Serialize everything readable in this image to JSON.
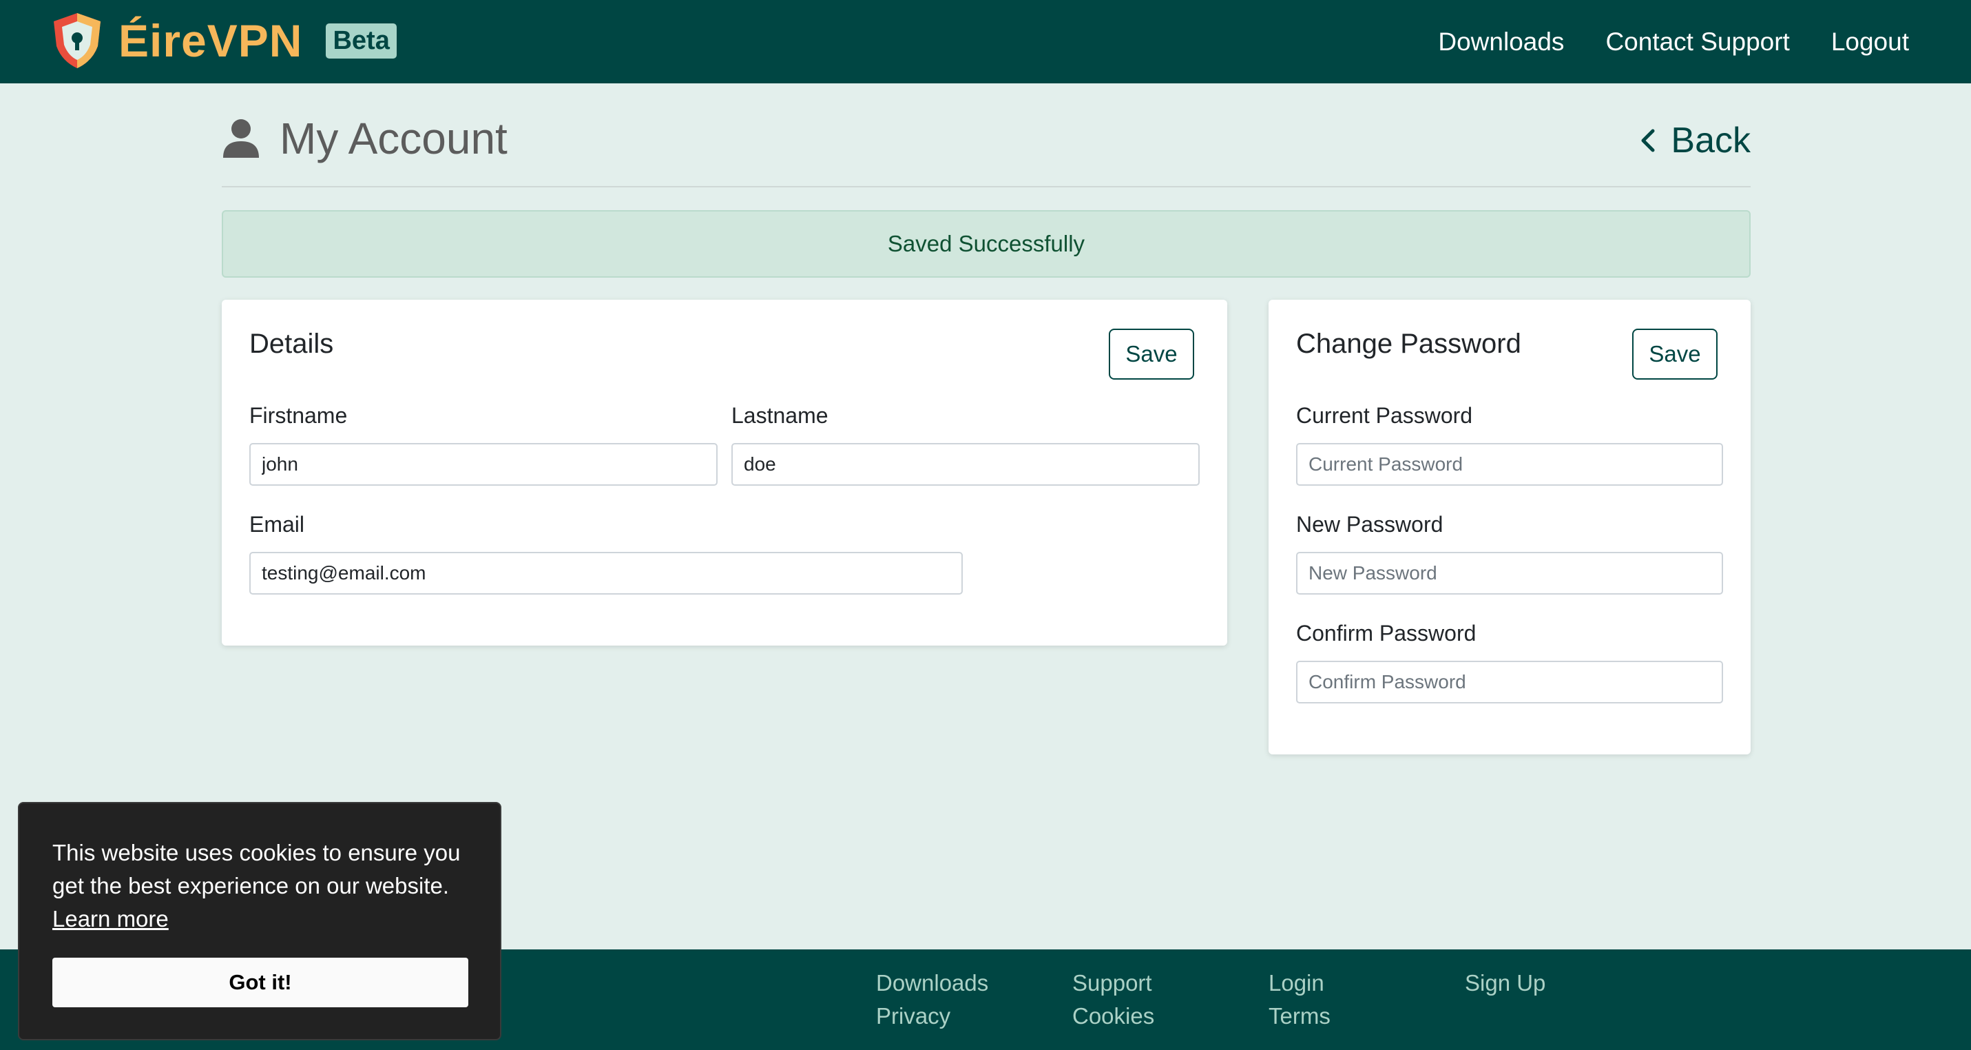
{
  "header": {
    "brand_name": "ÉireVPN",
    "beta_label": "Beta",
    "nav": [
      {
        "label": "Downloads"
      },
      {
        "label": "Contact Support"
      },
      {
        "label": "Logout"
      }
    ]
  },
  "page": {
    "title": "My Account",
    "back_label": "Back"
  },
  "alert": {
    "message": "Saved Successfully"
  },
  "details": {
    "title": "Details",
    "save_label": "Save",
    "firstname": {
      "label": "Firstname",
      "value": "john"
    },
    "lastname": {
      "label": "Lastname",
      "value": "doe"
    },
    "email": {
      "label": "Email",
      "value": "testing@email.com"
    }
  },
  "password": {
    "title": "Change Password",
    "save_label": "Save",
    "current": {
      "label": "Current Password",
      "placeholder": "Current Password"
    },
    "new": {
      "label": "New Password",
      "placeholder": "New Password"
    },
    "confirm": {
      "label": "Confirm Password",
      "placeholder": "Confirm Password"
    }
  },
  "cookie": {
    "text": "This website uses cookies to ensure you get the best experience on our website.",
    "learn_more": "Learn more",
    "button": "Got it!"
  },
  "footer": {
    "links": [
      {
        "label": "Downloads"
      },
      {
        "label": "Privacy"
      },
      {
        "label": "Support"
      },
      {
        "label": "Cookies"
      },
      {
        "label": "Login"
      },
      {
        "label": "Terms"
      },
      {
        "label": "Sign Up"
      }
    ]
  },
  "colors": {
    "primary": "#004643",
    "brand_accent": "#f6b75a",
    "background": "#e3efec",
    "success_bg": "#d1e7dd",
    "success_text": "#0f5132"
  },
  "icons": [
    "shield-logo-icon",
    "user-icon",
    "chevron-left-icon"
  ]
}
